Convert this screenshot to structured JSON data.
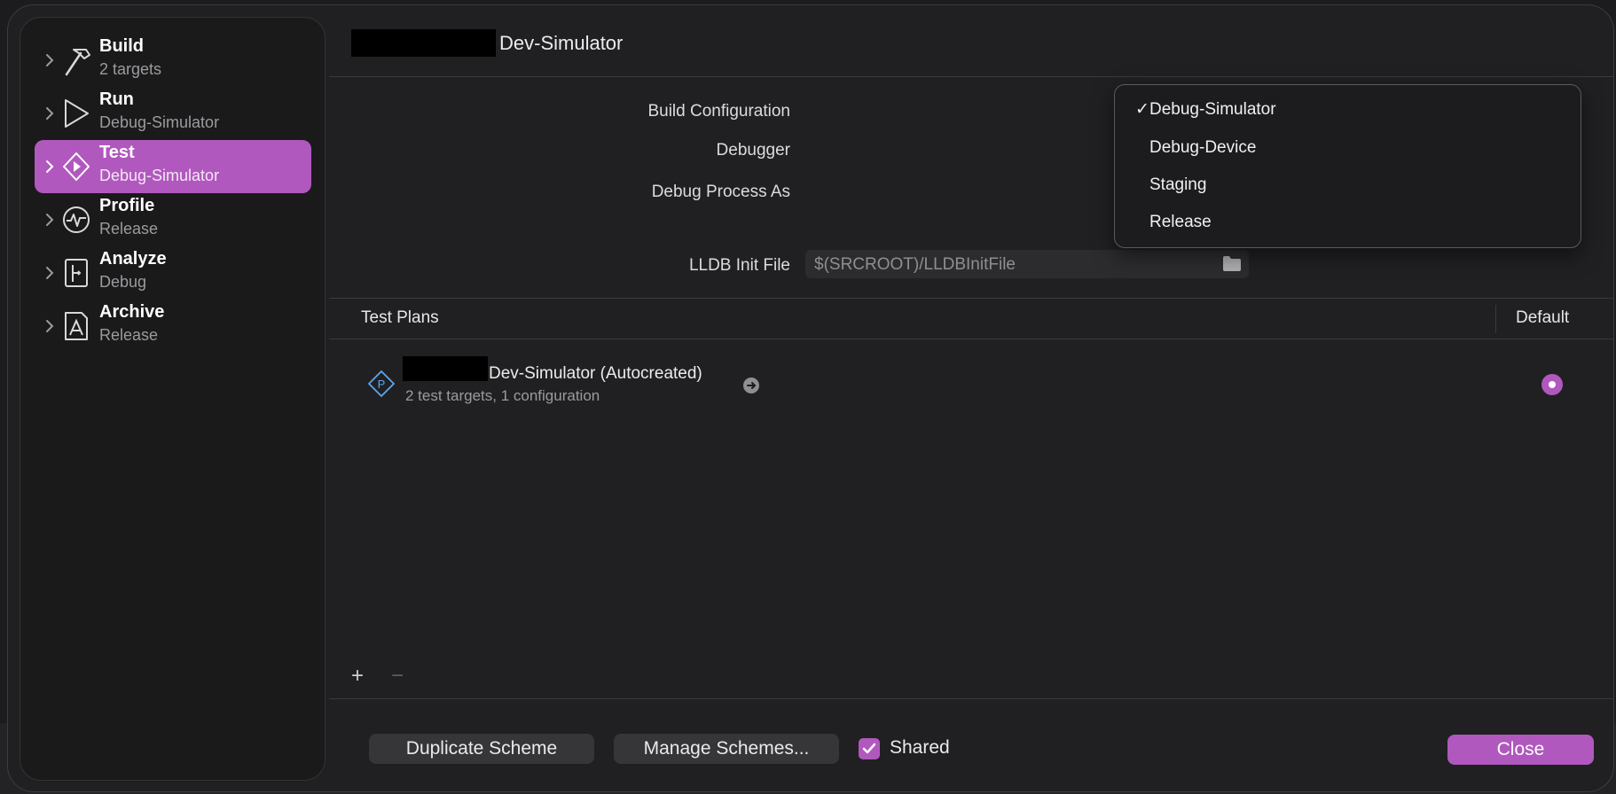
{
  "sidebar": {
    "items": [
      {
        "title": "Build",
        "subtitle": "2 targets"
      },
      {
        "title": "Run",
        "subtitle": "Debug-Simulator"
      },
      {
        "title": "Test",
        "subtitle": "Debug-Simulator",
        "selected": true
      },
      {
        "title": "Profile",
        "subtitle": "Release"
      },
      {
        "title": "Analyze",
        "subtitle": "Debug"
      },
      {
        "title": "Archive",
        "subtitle": "Release"
      }
    ]
  },
  "header": {
    "scheme_name": "Dev-Simulator"
  },
  "form": {
    "build_configuration_label": "Build Configuration",
    "debugger_label": "Debugger",
    "debug_process_label": "Debug Process As",
    "lldb_label": "LLDB Init File",
    "lldb_value": "$(SRCROOT)/LLDBInitFile"
  },
  "dropdown": {
    "options": [
      "Debug-Simulator",
      "Debug-Device",
      "Staging",
      "Release"
    ],
    "selected": "Debug-Simulator",
    "check_glyph": "✓"
  },
  "test_plans": {
    "header": "Test Plans",
    "default_header": "Default",
    "plan": {
      "name": "Dev-Simulator (Autocreated)",
      "details": "2 test targets, 1 configuration",
      "icon_letter": "P",
      "is_default": true
    }
  },
  "footer": {
    "add": "+",
    "remove": "−",
    "duplicate": "Duplicate Scheme",
    "manage": "Manage Schemes...",
    "shared_label": "Shared",
    "shared_checked": true,
    "close": "Close"
  },
  "colors": {
    "accent": "#b158be",
    "background": "#202022",
    "sidebar": "#1a1a1b"
  }
}
